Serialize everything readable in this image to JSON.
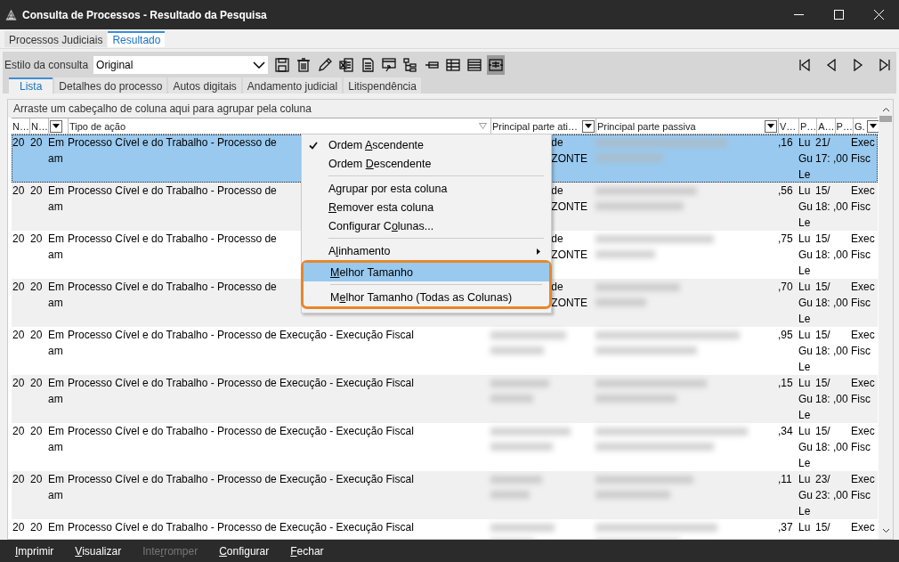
{
  "window": {
    "title": "Consulta de Processos - Resultado da Pesquisa"
  },
  "top_tabs": [
    {
      "label": "Processos Judiciais",
      "selected": false
    },
    {
      "label": "Resultado",
      "selected": true
    }
  ],
  "toolbar": {
    "style_label": "Estilo da consulta",
    "style_value": "Original",
    "buttons": [
      {
        "selected": false
      },
      {
        "selected": false
      },
      {
        "selected": false
      },
      {
        "selected": false
      },
      {
        "selected": false
      },
      {
        "selected": false
      },
      {
        "selected": false
      },
      {
        "selected": false
      },
      {
        "selected": false
      },
      {
        "selected": false
      },
      {
        "selected": true
      }
    ]
  },
  "inner_tabs": [
    {
      "label": "Lista",
      "selected": true
    },
    {
      "label": "Detalhes do processo",
      "selected": false
    },
    {
      "label": "Autos digitais",
      "selected": false
    },
    {
      "label": "Andamento judicial",
      "selected": false
    },
    {
      "label": "Litispendência",
      "selected": false
    }
  ],
  "group_hint": "Arraste um cabeçalho de coluna aqui para agrupar pela coluna",
  "columns": [
    {
      "label": "N…",
      "dropdown": false,
      "sorted": false
    },
    {
      "label": "N…",
      "dropdown": false,
      "sorted": false
    },
    {
      "dropdown": true,
      "sorted": false
    },
    {
      "label": "Tipo de ação",
      "dropdown": false,
      "sorted": true
    },
    {
      "label": "Principal parte ati…",
      "dropdown": true,
      "sorted": false
    },
    {
      "label": "Principal parte passiva",
      "dropdown": true,
      "sorted": false
    },
    {
      "label": "V…",
      "dropdown": false,
      "sorted": false
    },
    {
      "label": "P…",
      "dropdown": false,
      "sorted": false
    },
    {
      "label": "A…",
      "dropdown": false,
      "sorted": false
    },
    {
      "label": "P…",
      "dropdown": false,
      "sorted": false
    },
    {
      "label": "G.",
      "dropdown": true,
      "sorted": false
    }
  ],
  "rows": [
    {
      "selected": true,
      "cells": [
        "20",
        "20",
        "Em\nam",
        "Processo Cível e do Trabalho - Processo de",
        {
          "kind": "covered",
          "text": "de\nZONTE"
        },
        {
          "kind": "blurred"
        },
        ",16",
        "Lu\nGu\nLe",
        "21/\n17:",
        "\n,00",
        "Exec\nFisc"
      ]
    },
    {
      "selected": false,
      "cells": [
        "20",
        "20",
        "Em\nam",
        "Processo Cível e do Trabalho - Processo de",
        {
          "kind": "covered",
          "text": "de\nZONTE"
        },
        {
          "kind": "blurred"
        },
        ",56",
        "Lu\nGu\nLe",
        "15/\n18:",
        "\n,00",
        "Exec\nFisc"
      ]
    },
    {
      "selected": false,
      "cells": [
        "20",
        "20",
        "Em\nam",
        "Processo Cível e do Trabalho - Processo de",
        {
          "kind": "covered",
          "text": "de\nZONTE"
        },
        {
          "kind": "blurred"
        },
        ",75",
        "Lu\nGu\nLe",
        "15/\n18:",
        "\n,00",
        "Exec\nFisc"
      ]
    },
    {
      "selected": false,
      "cells": [
        "20",
        "20",
        "Em\nam",
        "Processo Cível e do Trabalho - Processo de",
        {
          "kind": "covered",
          "text": "de\nZONTE"
        },
        {
          "kind": "blurred"
        },
        ",70",
        "Lu\nGu\nLe",
        "15/\n18:",
        "\n,00",
        "Exec\nFisc"
      ]
    },
    {
      "selected": false,
      "cells": [
        "20",
        "20",
        "Em\nam",
        "Processo Cível e do Trabalho - Processo de Execução - Execução Fiscal",
        {
          "kind": "blurred"
        },
        {
          "kind": "blurred"
        },
        ",95",
        "Lu\nGu\nLe",
        "15/\n18:",
        "\n,00",
        "Exec\nFisc"
      ]
    },
    {
      "selected": false,
      "cells": [
        "20",
        "20",
        "Em\nam",
        "Processo Cível e do Trabalho - Processo de Execução - Execução Fiscal",
        {
          "kind": "blurred"
        },
        {
          "kind": "blurred"
        },
        ",15",
        "Lu\nGu\nLe",
        "15/\n18:",
        "\n,00",
        "Exec\nFisc"
      ]
    },
    {
      "selected": false,
      "cells": [
        "20",
        "20",
        "Em\nam",
        "Processo Cível e do Trabalho - Processo de Execução - Execução Fiscal",
        {
          "kind": "blurred"
        },
        {
          "kind": "blurred"
        },
        ",34",
        "Lu\nGu\nLe",
        "15/\n18:",
        "\n,00",
        "Exec\nFisc"
      ]
    },
    {
      "selected": false,
      "cells": [
        "20",
        "20",
        "Em\nam",
        "Processo Cível e do Trabalho - Processo de Execução - Execução Fiscal",
        {
          "kind": "blurred"
        },
        {
          "kind": "blurred"
        },
        ",11",
        "Lu\nGu\nLe",
        "23/\n23:",
        "\n,00",
        "Exec\nFisc"
      ]
    },
    {
      "selected": false,
      "cells": [
        "20",
        "20",
        "Em",
        "Processo Cível e do Trabalho - Processo de Execução - Execução Fiscal",
        {
          "kind": "blurred"
        },
        {
          "kind": "blurred"
        },
        ",37",
        "Lu",
        "15/",
        {
          "kind": "empty"
        },
        "Exec"
      ]
    }
  ],
  "context_menu": [
    {
      "kind": "item",
      "label": {
        "before": "Ordem ",
        "key": "A",
        "after": "scendente"
      },
      "checked": true,
      "selected": false,
      "submenu": false,
      "framed": false
    },
    {
      "kind": "item",
      "label": {
        "before": "Ordem ",
        "key": "D",
        "after": "escendente"
      },
      "checked": false,
      "selected": false,
      "submenu": false,
      "framed": false
    },
    {
      "kind": "separator",
      "framed": false
    },
    {
      "kind": "item",
      "label": {
        "before": "A",
        "key": "g",
        "after": "rupar por esta coluna"
      },
      "checked": false,
      "selected": false,
      "submenu": false,
      "framed": false
    },
    {
      "kind": "item",
      "label": {
        "key": "R",
        "after": "emover esta coluna"
      },
      "checked": false,
      "selected": false,
      "submenu": false,
      "framed": false
    },
    {
      "kind": "item",
      "label": {
        "before": "Configurar C",
        "key": "o",
        "after": "lunas..."
      },
      "checked": false,
      "selected": false,
      "submenu": false,
      "framed": false
    },
    {
      "kind": "separator",
      "framed": false
    },
    {
      "kind": "item",
      "label": {
        "before": "A",
        "key": "l",
        "after": "inhamento"
      },
      "checked": false,
      "selected": false,
      "submenu": true,
      "framed": false
    },
    {
      "kind": "item",
      "label": {
        "key": "M",
        "after": "elhor Tamanho"
      },
      "checked": false,
      "selected": true,
      "submenu": false,
      "framed": true
    },
    {
      "kind": "separator",
      "framed": true
    },
    {
      "kind": "item",
      "label": {
        "before": "M",
        "key": "e",
        "after": "lhor Tamanho (Todas as Colunas)"
      },
      "checked": false,
      "selected": false,
      "submenu": false,
      "framed": true
    }
  ],
  "footer_buttons": [
    {
      "label": {
        "key": "I",
        "after": "mprimir"
      },
      "disabled": false
    },
    {
      "label": {
        "key": "V",
        "after": "isualizar"
      },
      "disabled": false
    },
    {
      "label": {
        "before": "Inte",
        "key": "r",
        "after": "romper"
      },
      "disabled": true
    },
    {
      "label": {
        "key": "C",
        "after": "onfigurar"
      },
      "disabled": false
    },
    {
      "label": {
        "key": "F",
        "after": "echar"
      },
      "disabled": false
    }
  ]
}
